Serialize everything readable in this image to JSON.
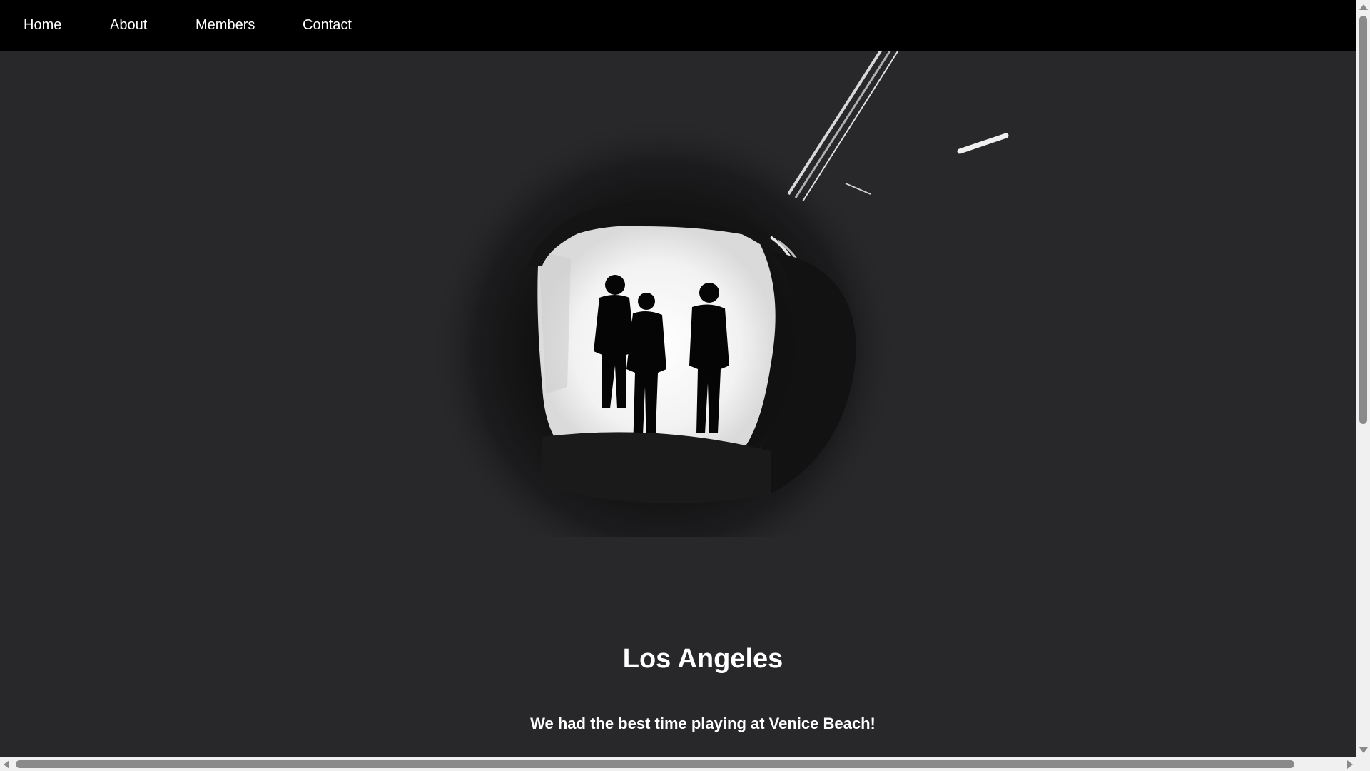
{
  "nav": {
    "home": "Home",
    "about": "About",
    "members": "Members",
    "contact": "Contact"
  },
  "hero": {
    "title": "Los Angeles",
    "subtitle": "We had the best time playing at Venice Beach!"
  },
  "colors": {
    "navbar": "#000000",
    "background": "#28272a",
    "text": "#ffffff"
  }
}
